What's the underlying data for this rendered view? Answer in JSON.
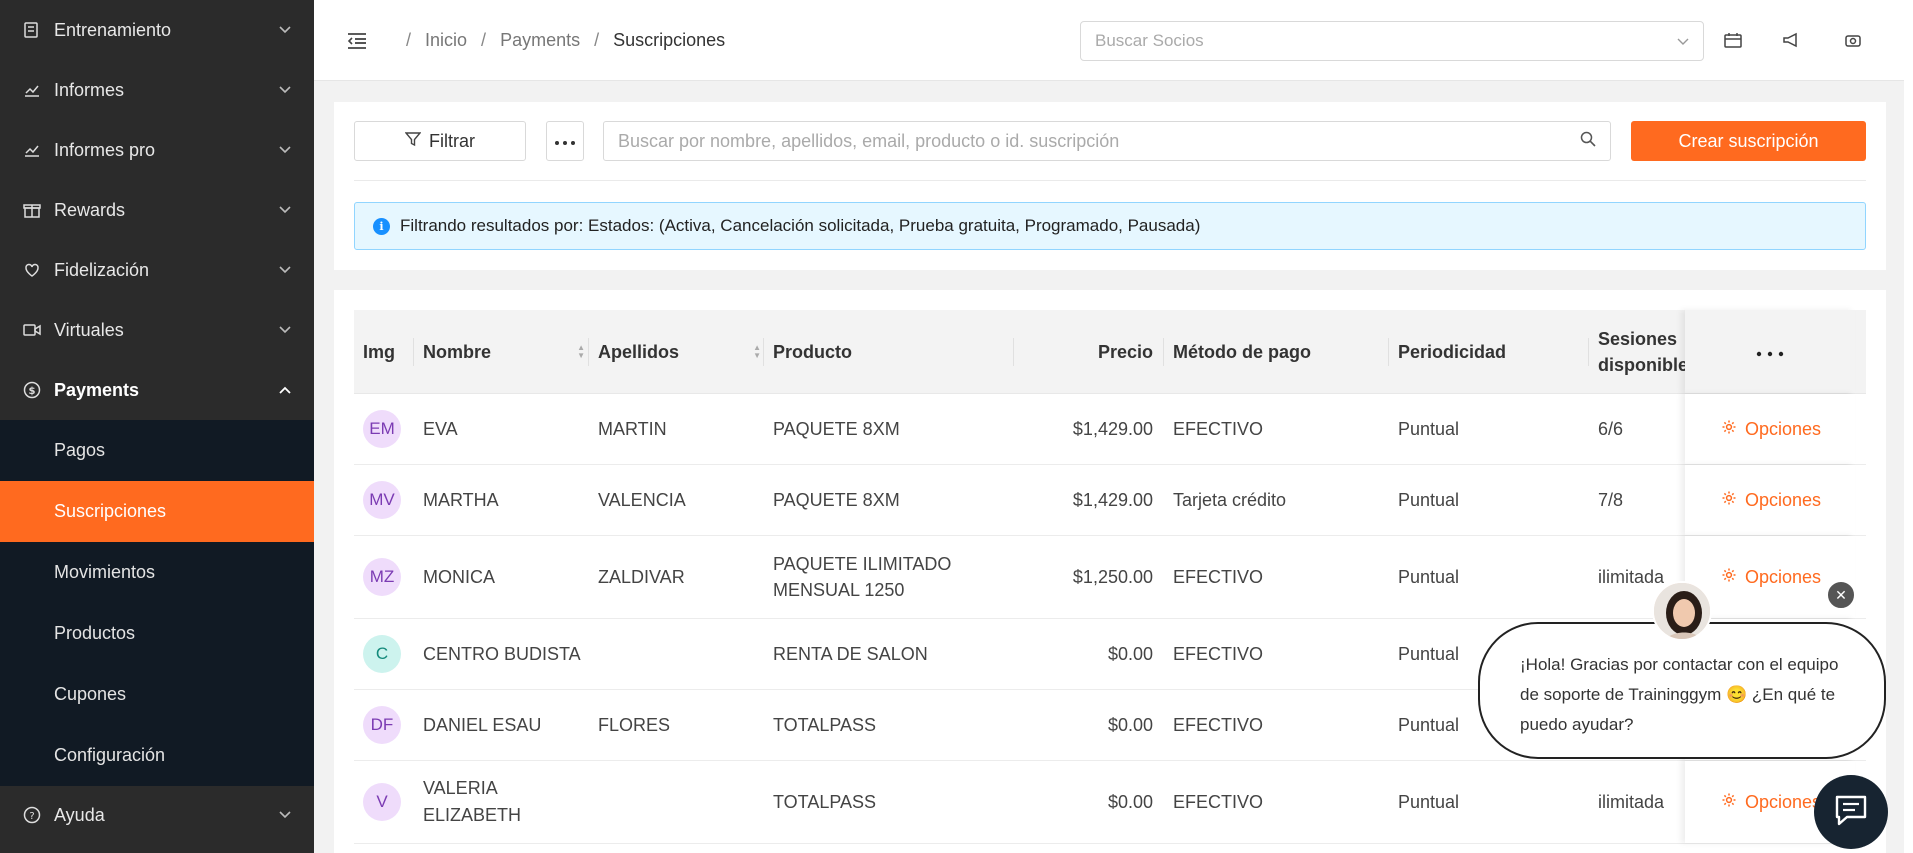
{
  "sidebar": {
    "items": [
      {
        "label": "Entrenamiento",
        "icon": "dumbbell-icon"
      },
      {
        "label": "Informes",
        "icon": "chart-line-icon"
      },
      {
        "label": "Informes pro",
        "icon": "chart-line-icon"
      },
      {
        "label": "Rewards",
        "icon": "gift-icon"
      },
      {
        "label": "Fidelización",
        "icon": "heart-icon"
      },
      {
        "label": "Virtuales",
        "icon": "video-icon"
      },
      {
        "label": "Payments",
        "icon": "dollar-circle-icon"
      }
    ],
    "submenu": [
      "Pagos",
      "Suscripciones",
      "Movimientos",
      "Productos",
      "Cupones",
      "Configuración"
    ],
    "footer_item": {
      "label": "Ayuda",
      "icon": "question-circle-icon"
    }
  },
  "topbar": {
    "breadcrumb": [
      "Inicio",
      "Payments",
      "Suscripciones"
    ],
    "member_search_placeholder": "Buscar Socios"
  },
  "toolbar": {
    "filter_label": "Filtrar",
    "search_placeholder": "Buscar por nombre, apellidos, email, producto o id. suscripción",
    "create_label": "Crear suscripción"
  },
  "info_banner": "Filtrando resultados por: Estados: (Activa, Cancelación solicitada, Prueba gratuita, Programado, Pausada)",
  "table": {
    "headers": {
      "img": "Img",
      "nombre": "Nombre",
      "apellidos": "Apellidos",
      "producto": "Producto",
      "precio": "Precio",
      "metodo": "Método de pago",
      "periodicidad": "Periodicidad",
      "sesiones_1": "Sesiones",
      "sesiones_2": "disponible"
    },
    "options_label": "Opciones",
    "rows": [
      {
        "initials": "EM",
        "nombre": "EVA",
        "apellidos": "MARTIN",
        "producto": "PAQUETE 8XM",
        "producto_2": "",
        "precio": "$1,429.00",
        "metodo": "EFECTIVO",
        "periodicidad": "Puntual",
        "sesiones": "6/6",
        "avatar_bg": "#efdcfb",
        "avatar_fg": "#7b3bb3"
      },
      {
        "initials": "MV",
        "nombre": "MARTHA",
        "apellidos": "VALENCIA",
        "producto": "PAQUETE 8XM",
        "producto_2": "",
        "precio": "$1,429.00",
        "metodo": "Tarjeta crédito",
        "periodicidad": "Puntual",
        "sesiones": "7/8",
        "avatar_bg": "#efdcfb",
        "avatar_fg": "#7b3bb3"
      },
      {
        "initials": "MZ",
        "nombre": "MONICA",
        "apellidos": "ZALDIVAR",
        "producto": "PAQUETE ILIMITADO",
        "producto_2": "MENSUAL 1250",
        "precio": "$1,250.00",
        "metodo": "EFECTIVO",
        "periodicidad": "Puntual",
        "sesiones": "ilimitada",
        "avatar_bg": "#efdcfb",
        "avatar_fg": "#7b3bb3"
      },
      {
        "initials": "C",
        "nombre": "CENTRO BUDISTA",
        "nombre_2": "",
        "apellidos": "",
        "producto": "RENTA DE SALON",
        "producto_2": "",
        "precio": "$0.00",
        "metodo": "EFECTIVO",
        "periodicidad": "Puntual",
        "sesiones": "",
        "avatar_bg": "#cdf3ee",
        "avatar_fg": "#148a7b"
      },
      {
        "initials": "DF",
        "nombre": "DANIEL ESAU",
        "apellidos": "FLORES",
        "producto": "TOTALPASS",
        "producto_2": "",
        "precio": "$0.00",
        "metodo": "EFECTIVO",
        "periodicidad": "Puntual",
        "sesiones": "",
        "avatar_bg": "#efdcfb",
        "avatar_fg": "#7b3bb3"
      },
      {
        "initials": "V",
        "nombre": "VALERIA",
        "nombre_2": "ELIZABETH",
        "apellidos": "",
        "producto": "TOTALPASS",
        "producto_2": "",
        "precio": "$0.00",
        "metodo": "EFECTIVO",
        "periodicidad": "Puntual",
        "sesiones": "ilimitada",
        "avatar_bg": "#efdcfb",
        "avatar_fg": "#7b3bb3"
      }
    ]
  },
  "chat": {
    "message": "¡Hola! Gracias por contactar con el equipo de soporte de Traininggym 😊 ¿En qué te puedo ayudar?"
  },
  "colors": {
    "accent": "#ff6a1f",
    "sidebar_bg": "#2b2b2b",
    "submenu_bg": "#111a24",
    "info_bg": "#e6f7ff"
  }
}
